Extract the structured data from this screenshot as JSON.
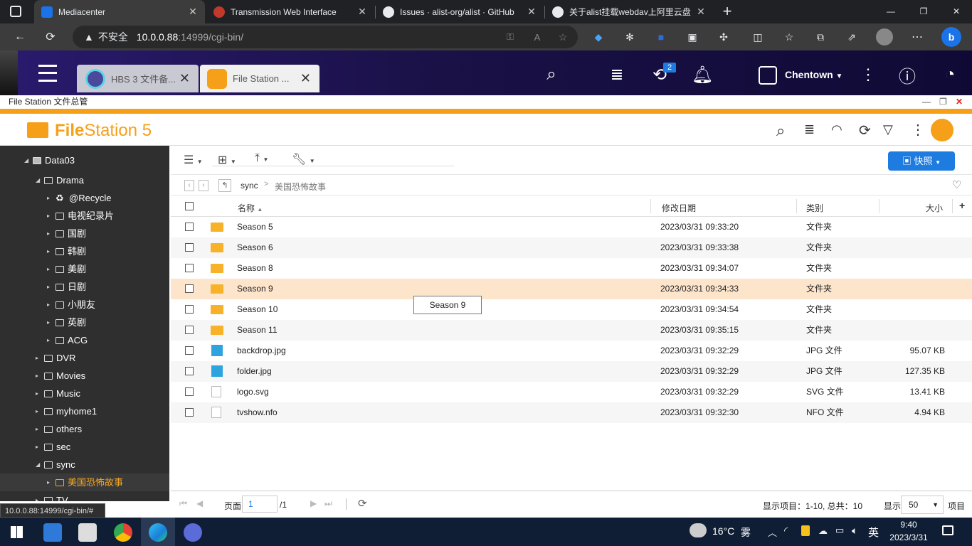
{
  "browser": {
    "tabs": [
      {
        "title": "Mediacenter",
        "active": true
      },
      {
        "title": "Transmission Web Interface",
        "active": false
      },
      {
        "title": "Issues · alist-org/alist · GitHub",
        "active": false
      },
      {
        "title": "关于alist挂载webdav上阿里云盘",
        "active": false
      }
    ],
    "new_tab": "+",
    "security_label": "不安全",
    "url_host": "10.0.0.88",
    "url_rest": ":14999/cgi-bin/",
    "win_min": "—",
    "win_max": "❐",
    "win_close": "✕"
  },
  "qts": {
    "app_tabs": [
      {
        "title": "HBS 3 文件备...",
        "active": false
      },
      {
        "title": "File Station ...",
        "active": true
      }
    ],
    "badge": "2",
    "user": "Chentown"
  },
  "window": {
    "title": "File Station 文件总管"
  },
  "fs": {
    "logo_bold": "File",
    "logo_rest": "Station 5",
    "snapshot_label": "快照",
    "breadcrumb": [
      "sync",
      "美国恐怖故事"
    ],
    "columns": {
      "name": "名称",
      "date": "修改日期",
      "type": "类别",
      "size": "大小"
    },
    "files": [
      {
        "name": "Season 5",
        "date": "2023/03/31 09:33:20",
        "type": "文件夹",
        "size": "",
        "kind": "folder",
        "highlight": false
      },
      {
        "name": "Season 6",
        "date": "2023/03/31 09:33:38",
        "type": "文件夹",
        "size": "",
        "kind": "folder",
        "highlight": false
      },
      {
        "name": "Season 8",
        "date": "2023/03/31 09:34:07",
        "type": "文件夹",
        "size": "",
        "kind": "folder",
        "highlight": false
      },
      {
        "name": "Season 9",
        "date": "2023/03/31 09:34:33",
        "type": "文件夹",
        "size": "",
        "kind": "folder",
        "highlight": true
      },
      {
        "name": "Season 10",
        "date": "2023/03/31 09:34:54",
        "type": "文件夹",
        "size": "",
        "kind": "folder",
        "highlight": false
      },
      {
        "name": "Season 11",
        "date": "2023/03/31 09:35:15",
        "type": "文件夹",
        "size": "",
        "kind": "folder",
        "highlight": false
      },
      {
        "name": "backdrop.jpg",
        "date": "2023/03/31 09:32:29",
        "type": "JPG 文件",
        "size": "95.07 KB",
        "kind": "image",
        "highlight": false
      },
      {
        "name": "folder.jpg",
        "date": "2023/03/31 09:32:29",
        "type": "JPG 文件",
        "size": "127.35 KB",
        "kind": "image",
        "highlight": false
      },
      {
        "name": "logo.svg",
        "date": "2023/03/31 09:32:29",
        "type": "SVG 文件",
        "size": "13.41 KB",
        "kind": "doc",
        "highlight": false
      },
      {
        "name": "tvshow.nfo",
        "date": "2023/03/31 09:32:30",
        "type": "NFO 文件",
        "size": "4.94 KB",
        "kind": "doc",
        "highlight": false
      }
    ],
    "tooltip": "Season 9",
    "tree": [
      {
        "label": "Data03",
        "depth": 0,
        "arrow": "◢",
        "selected": false
      },
      {
        "label": "Drama",
        "depth": 1,
        "arrow": "◢",
        "selected": false
      },
      {
        "label": "@Recycle",
        "depth": 2,
        "arrow": "▸",
        "selected": false,
        "recycle": true
      },
      {
        "label": "电视纪录片",
        "depth": 2,
        "arrow": "▸",
        "selected": false
      },
      {
        "label": "国剧",
        "depth": 2,
        "arrow": "▸",
        "selected": false
      },
      {
        "label": "韩剧",
        "depth": 2,
        "arrow": "▸",
        "selected": false
      },
      {
        "label": "美剧",
        "depth": 2,
        "arrow": "▸",
        "selected": false
      },
      {
        "label": "日剧",
        "depth": 2,
        "arrow": "▸",
        "selected": false
      },
      {
        "label": "小朋友",
        "depth": 2,
        "arrow": "▸",
        "selected": false
      },
      {
        "label": "英剧",
        "depth": 2,
        "arrow": "▸",
        "selected": false
      },
      {
        "label": "ACG",
        "depth": 2,
        "arrow": "▸",
        "selected": false
      },
      {
        "label": "DVR",
        "depth": 1,
        "arrow": "▸",
        "selected": false
      },
      {
        "label": "Movies",
        "depth": 1,
        "arrow": "▸",
        "selected": false
      },
      {
        "label": "Music",
        "depth": 1,
        "arrow": "▸",
        "selected": false
      },
      {
        "label": "myhome1",
        "depth": 1,
        "arrow": "▸",
        "selected": false
      },
      {
        "label": "others",
        "depth": 1,
        "arrow": "▸",
        "selected": false
      },
      {
        "label": "sec",
        "depth": 1,
        "arrow": "▸",
        "selected": false
      },
      {
        "label": "sync",
        "depth": 1,
        "arrow": "◢",
        "selected": false
      },
      {
        "label": "美国恐怖故事",
        "depth": 2,
        "arrow": "▸",
        "selected": true
      },
      {
        "label": "TV",
        "depth": 1,
        "arrow": "▸",
        "selected": false
      }
    ],
    "footer": {
      "page_label": "页面",
      "page_value": "1",
      "page_total": "/1",
      "display_info": "显示项目：1-10, 总共：10",
      "show_label": "显示",
      "per_page": "50",
      "items_label": "项目"
    }
  },
  "status_url": "10.0.0.88:14999/cgi-bin/#",
  "taskbar": {
    "weather_temp": "16°C",
    "weather_desc": "雾",
    "lang": "英",
    "time": "9:40",
    "date": "2023/3/31"
  },
  "colors": {
    "accent": "#f6a01a",
    "snapshot": "#1e7be0",
    "highlight_row": "#fde5cc"
  }
}
